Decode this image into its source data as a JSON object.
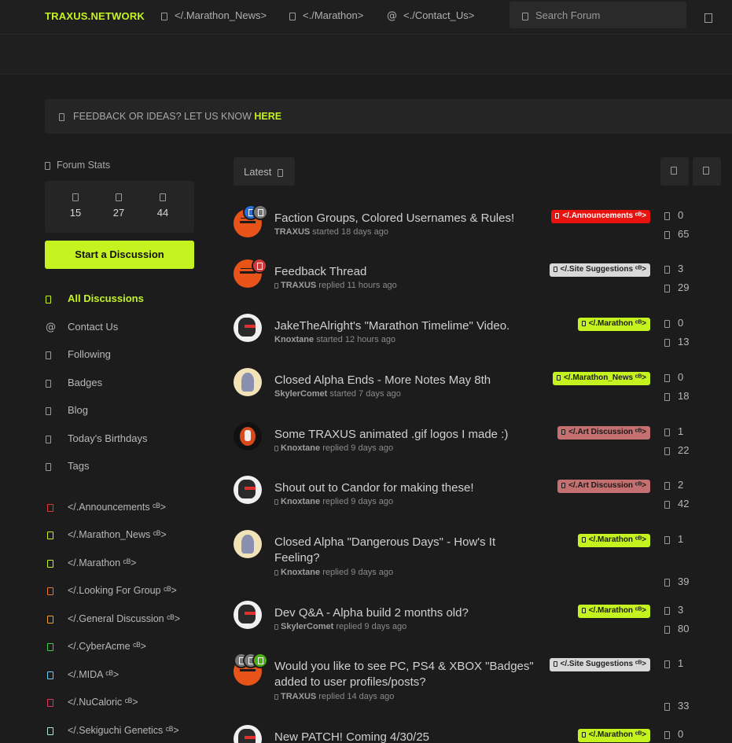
{
  "header": {
    "brand": "TRAXUS.NETWORK",
    "nav": [
      {
        "label": "</.Marathon_News>",
        "icon": "newspaper-icon"
      },
      {
        "label": "<./Marathon>",
        "icon": "gamepad-icon"
      },
      {
        "label": "<./Contact_Us>",
        "icon": "at-icon"
      }
    ],
    "search_placeholder": "Search Forum",
    "at_symbol": "@"
  },
  "feedback": {
    "text": "FEEDBACK OR IDEAS? LET US KNOW ",
    "link": "HERE"
  },
  "sidebar": {
    "stats_title": "Forum Stats",
    "stats": [
      {
        "icon": "users-icon",
        "value": "15"
      },
      {
        "icon": "discussions-icon",
        "value": "27"
      },
      {
        "icon": "posts-icon",
        "value": "44"
      }
    ],
    "start_button": "Start a Discussion",
    "nav": [
      {
        "label": "All Discussions",
        "icon": "discussions-icon",
        "active": true
      },
      {
        "label": "Contact Us",
        "icon": "at-icon",
        "active": false
      },
      {
        "label": "Following",
        "icon": "star-icon",
        "active": false
      },
      {
        "label": "Badges",
        "icon": "badge-icon",
        "active": false
      },
      {
        "label": "Blog",
        "icon": "blog-icon",
        "active": false
      },
      {
        "label": "Today's Birthdays",
        "icon": "cake-icon",
        "active": false
      },
      {
        "label": "Tags",
        "icon": "tags-icon",
        "active": false
      }
    ],
    "tags": [
      {
        "label": "</.Announcements ᶜᴮ>",
        "color": "#e8312f"
      },
      {
        "label": "</.Marathon_News ᶜᴮ>",
        "color": "#c5f31f"
      },
      {
        "label": "</.Marathon ᶜᴮ>",
        "color": "#c5f31f"
      },
      {
        "label": "</.Looking For Group ᶜᴮ>",
        "color": "#f0702a"
      },
      {
        "label": "</.General Discussion ᶜᴮ>",
        "color": "#f0a030"
      },
      {
        "label": "</.CyberAcme ᶜᴮ>",
        "color": "#3ad14a"
      },
      {
        "label": "</.MIDA ᶜᴮ>",
        "color": "#6fc8f0"
      },
      {
        "label": "</.NuCaloric ᶜᴮ>",
        "color": "#e8315a"
      },
      {
        "label": "</.Sekiguchi Genetics ᶜᴮ>",
        "color": "#a8e8d8"
      }
    ]
  },
  "list": {
    "sort_label": "Latest",
    "refresh_icon": "refresh-icon",
    "mark_read_icon": "check-icon"
  },
  "discussions": [
    {
      "title": "Faction Groups, Colored Usernames & Rules!",
      "author": "TRAXUS",
      "action": "started",
      "time": "18 days ago",
      "tag": "</.Announcements ᶜᴮ>",
      "tag_bg": "#e8120f",
      "tag_fg": "#ffffff",
      "replies": "0",
      "views": "65",
      "avatar": "orange"
    },
    {
      "title": "Feedback Thread",
      "author": "TRAXUS",
      "action": "replied",
      "time": "11 hours ago",
      "tag": "</.Site Suggestions ᶜᴮ>",
      "tag_bg": "#d8d8d8",
      "tag_fg": "#222222",
      "replies": "3",
      "views": "29",
      "avatar": "orange"
    },
    {
      "title": "JakeTheAlright's \"Marathon Timelime\" Video.",
      "author": "Knoxtane",
      "action": "started",
      "time": "12 hours ago",
      "tag": "</.Marathon ᶜᴮ>",
      "tag_bg": "#c5f31f",
      "tag_fg": "#1a1a1a",
      "replies": "0",
      "views": "13",
      "avatar": "mask"
    },
    {
      "title": "Closed Alpha Ends - More Notes May 8th",
      "author": "SkylerComet",
      "action": "started",
      "time": "7 days ago",
      "tag": "</.Marathon_News ᶜᴮ>",
      "tag_bg": "#c5f31f",
      "tag_fg": "#1a1a1a",
      "replies": "0",
      "views": "18",
      "avatar": "fox"
    },
    {
      "title": "Some TRAXUS animated .gif logos I made :)",
      "author": "Knoxtane",
      "action": "replied",
      "time": "9 days ago",
      "tag": "</.Art Discussion ᶜᴮ>",
      "tag_bg": "#c47070",
      "tag_fg": "#1a1a1a",
      "replies": "1",
      "views": "22",
      "avatar": "dark"
    },
    {
      "title": "Shout out to Candor for making these!",
      "author": "Knoxtane",
      "action": "replied",
      "time": "9 days ago",
      "tag": "</.Art Discussion ᶜᴮ>",
      "tag_bg": "#c47070",
      "tag_fg": "#1a1a1a",
      "replies": "2",
      "views": "42",
      "avatar": "mask"
    },
    {
      "title": "Closed Alpha \"Dangerous Days\" - How's It Feeling?",
      "author": "Knoxtane",
      "action": "replied",
      "time": "9 days ago",
      "tag": "</.Marathon ᶜᴮ>",
      "tag_bg": "#c5f31f",
      "tag_fg": "#1a1a1a",
      "replies": "1",
      "views": "39",
      "avatar": "fox"
    },
    {
      "title": "Dev Q&A - Alpha build 2 months old?",
      "author": "SkylerComet",
      "action": "replied",
      "time": "9 days ago",
      "tag": "</.Marathon ᶜᴮ>",
      "tag_bg": "#c5f31f",
      "tag_fg": "#1a1a1a",
      "replies": "3",
      "views": "80",
      "avatar": "mask"
    },
    {
      "title": "Would you like to see PC, PS4 & XBOX \"Badges\" added to user profiles/posts?",
      "author": "TRAXUS",
      "action": "replied",
      "time": "14 days ago",
      "tag": "</.Site Suggestions ᶜᴮ>",
      "tag_bg": "#d8d8d8",
      "tag_fg": "#222222",
      "replies": "1",
      "views": "33",
      "avatar": "orange"
    },
    {
      "title": "New PATCH! Coming 4/30/25",
      "author": "",
      "action": "",
      "time": "",
      "tag": "</.Marathon ᶜᴮ>",
      "tag_bg": "#c5f31f",
      "tag_fg": "#1a1a1a",
      "replies": "0",
      "views": "",
      "avatar": "mask"
    }
  ],
  "colors": {
    "accent": "#c5f31f",
    "bg": "#1c1c1c",
    "panel": "#252525"
  }
}
